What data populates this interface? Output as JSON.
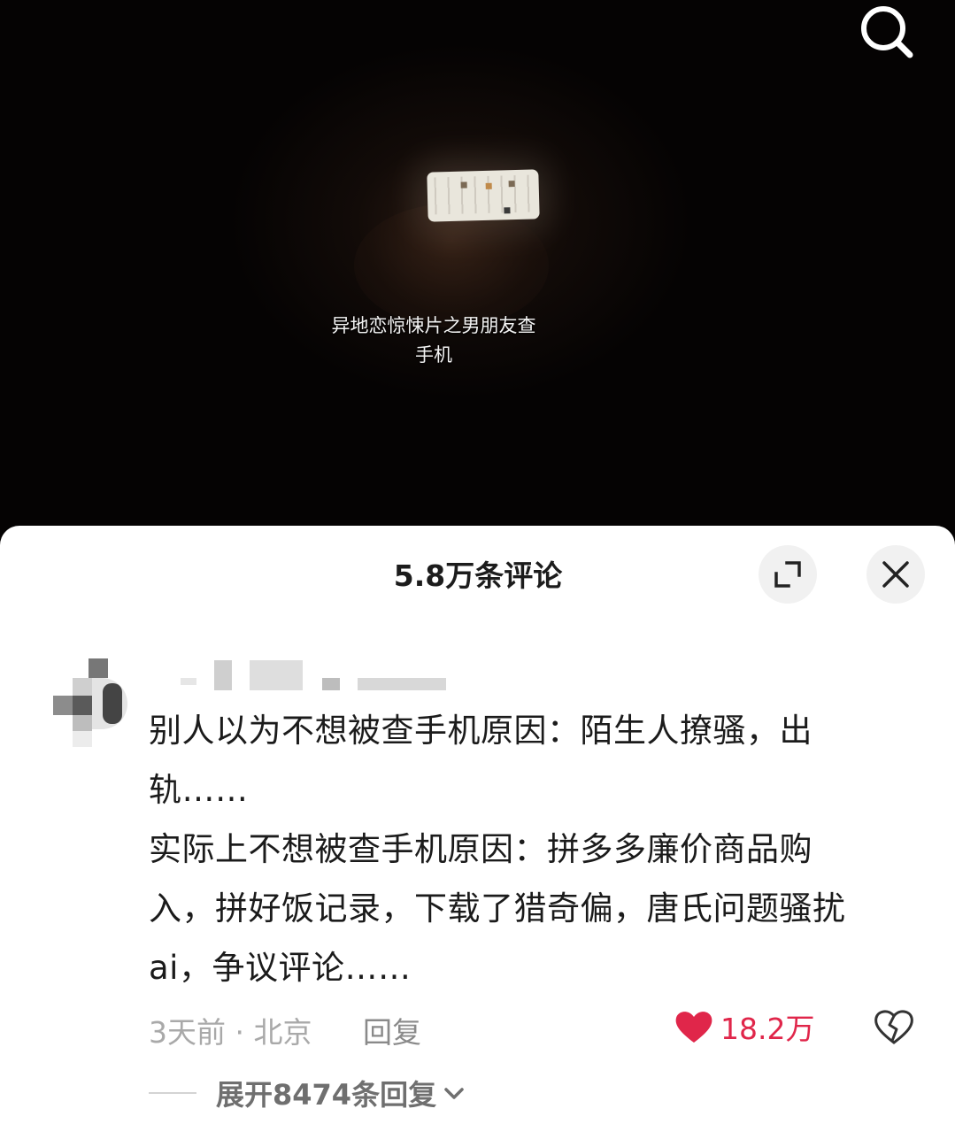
{
  "video": {
    "caption_line1": "异地恋惊悚片之男朋友查",
    "caption_line2": "手机",
    "search_icon": "search-icon"
  },
  "comments_panel": {
    "title": "5.8万条评论",
    "expand_icon": "expand-icon",
    "close_icon": "close-icon"
  },
  "comment": {
    "text": "别人以为不想被查手机原因：陌生人撩骚，出\n轨……\n实际上不想被查手机原因：拼多多廉价商品购\n入，拼好饭记录，下载了猎奇偏，唐氏问题骚扰\nai，争议评论……",
    "time_location": "3天前 · 北京",
    "reply_label": "回复",
    "like_count": "18.2万",
    "liked": true,
    "like_color": "#e0264a",
    "expand_replies_label": "展开8474条回复"
  }
}
